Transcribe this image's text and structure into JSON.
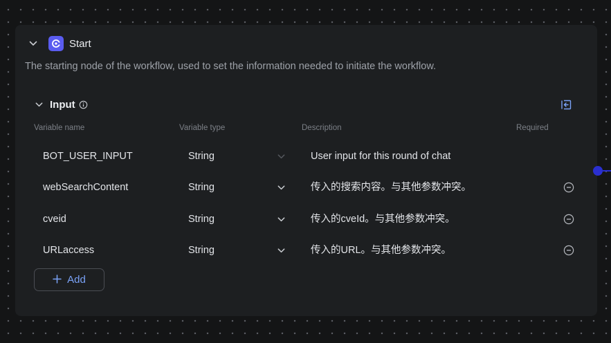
{
  "node": {
    "title": "Start",
    "description": "The starting node of the workflow, used to set the information needed to initiate the workflow.",
    "icon": "start-node-icon",
    "accent_color": "#5a5cf0"
  },
  "input": {
    "title": "Input",
    "columns": {
      "name": "Variable name",
      "type": "Variable type",
      "description": "Description",
      "required": "Required"
    },
    "rows": [
      {
        "name": "BOT_USER_INPUT",
        "type": "String",
        "description": "User input for this round of chat",
        "removable": false
      },
      {
        "name": "webSearchContent",
        "type": "String",
        "description": "传入的搜索内容。与其他参数冲突。",
        "removable": true
      },
      {
        "name": "cveid",
        "type": "String",
        "description": "传入的cveId。与其他参数冲突。",
        "removable": true
      },
      {
        "name": "URLaccess",
        "type": "String",
        "description": "传入的URL。与其他参数冲突。",
        "removable": true
      }
    ],
    "add_label": "Add"
  },
  "colors": {
    "link_accent": "#7aa2f7",
    "edge_handle": "#2a2fd0"
  }
}
